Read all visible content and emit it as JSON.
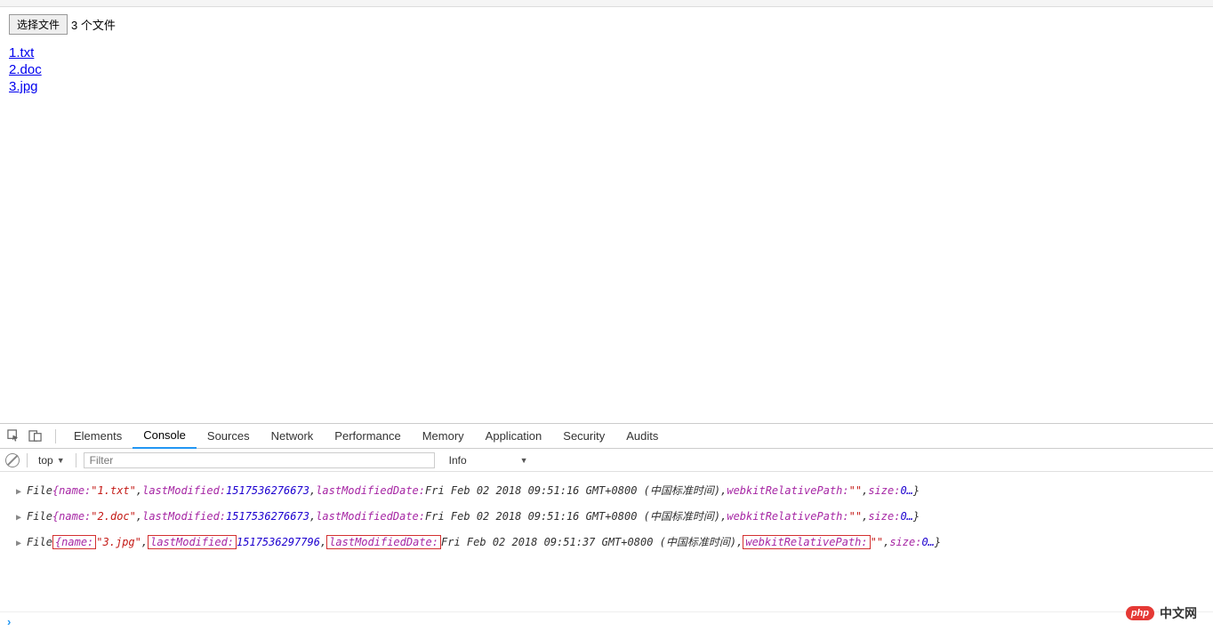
{
  "toolbar": {
    "files_hint": ""
  },
  "page": {
    "choose_file_btn": "选择文件",
    "file_count": "3 个文件",
    "files": [
      "1.txt",
      "2.doc",
      "3.jpg"
    ]
  },
  "devtools": {
    "tabs": [
      "Elements",
      "Console",
      "Sources",
      "Network",
      "Performance",
      "Memory",
      "Application",
      "Security",
      "Audits"
    ],
    "active_tab_index": 1,
    "filter": {
      "context": "top",
      "placeholder": "Filter",
      "level": "Info"
    },
    "console": {
      "lines": [
        {
          "type": "File",
          "highlighted": false,
          "props": [
            {
              "name": "name",
              "val": "\"1.txt\"",
              "kind": "str"
            },
            {
              "name": "lastModified",
              "val": "1517536276673",
              "kind": "num"
            },
            {
              "name": "lastModifiedDate",
              "val": "Fri Feb 02 2018 09:51:16 GMT+0800 (中国标准时间)",
              "kind": "plain"
            },
            {
              "name": "webkitRelativePath",
              "val": "\"\"",
              "kind": "str"
            },
            {
              "name": "size",
              "val": "0…",
              "kind": "num"
            }
          ]
        },
        {
          "type": "File",
          "highlighted": false,
          "props": [
            {
              "name": "name",
              "val": "\"2.doc\"",
              "kind": "str"
            },
            {
              "name": "lastModified",
              "val": "1517536276673",
              "kind": "num"
            },
            {
              "name": "lastModifiedDate",
              "val": "Fri Feb 02 2018 09:51:16 GMT+0800 (中国标准时间)",
              "kind": "plain"
            },
            {
              "name": "webkitRelativePath",
              "val": "\"\"",
              "kind": "str"
            },
            {
              "name": "size",
              "val": "0…",
              "kind": "num"
            }
          ]
        },
        {
          "type": "File",
          "highlighted": true,
          "props": [
            {
              "name": "name",
              "val": "\"3.jpg\"",
              "kind": "str",
              "hl": "name"
            },
            {
              "name": "lastModified",
              "val": "1517536297796",
              "kind": "num",
              "hl": "name"
            },
            {
              "name": "lastModifiedDate",
              "val": "Fri Feb 02 2018 09:51:37 GMT+0800 (中国标准时间)",
              "kind": "plain",
              "hl": "name"
            },
            {
              "name": "webkitRelativePath",
              "val": "\"\"",
              "kind": "str",
              "hl": "name"
            },
            {
              "name": "size",
              "val": "0…",
              "kind": "num"
            }
          ]
        }
      ]
    }
  },
  "watermark": {
    "logo": "php",
    "text": "中文网"
  }
}
